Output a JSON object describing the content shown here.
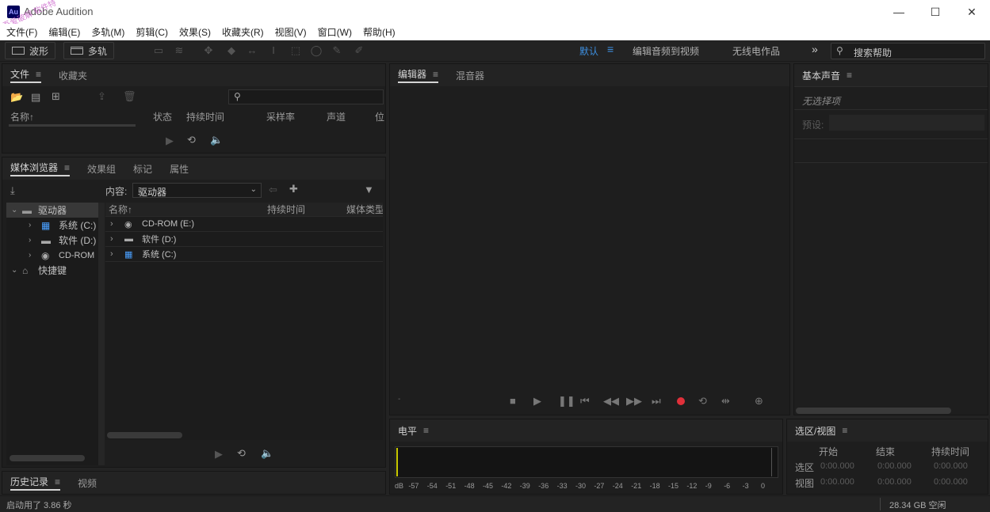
{
  "window": {
    "app_badge": "Au",
    "title": "Adobe Audition",
    "minimize": "—",
    "maximize": "☐",
    "close": "✕"
  },
  "watermark": "吾爱破解 软件特",
  "menu": [
    "文件(F)",
    "编辑(E)",
    "多轨(M)",
    "剪辑(C)",
    "效果(S)",
    "收藏夹(R)",
    "视图(V)",
    "窗口(W)",
    "帮助(H)"
  ],
  "toolbar": {
    "waveform_label": "波形",
    "multitrack_label": "多轨",
    "workspaces": {
      "default": "默认",
      "edit_to_video": "编辑音频到视频",
      "radio": "无线电作品",
      "more": "»"
    },
    "search_placeholder": "搜索帮助"
  },
  "files_panel": {
    "tabs": [
      "文件",
      "收藏夹"
    ],
    "columns": [
      "名称↑",
      "状态",
      "持续时间",
      "采样率",
      "声道",
      "位"
    ]
  },
  "media_panel": {
    "tabs": [
      "媒体浏览器",
      "效果组",
      "标记",
      "属性"
    ],
    "content_label": "内容:",
    "content_value": "驱动器",
    "tree": [
      {
        "label": "驱动器",
        "level": 0,
        "expanded": true,
        "icon": "drive-group-icon"
      },
      {
        "label": "系统 (C:)",
        "level": 1,
        "icon": "system-drive-icon"
      },
      {
        "label": "软件 (D:)",
        "level": 1,
        "icon": "hdd-icon"
      },
      {
        "label": "CD-ROM",
        "level": 1,
        "icon": "cdrom-icon"
      },
      {
        "label": "快捷键",
        "level": 0,
        "expanded": true,
        "icon": "shortcut-icon"
      }
    ],
    "list_columns": [
      "名称↑",
      "持续时间",
      "媒体类型"
    ],
    "list": [
      "CD-ROM (E:)",
      "软件 (D:)",
      "系统 (C:)"
    ]
  },
  "history_panel": {
    "tabs": [
      "历史记录",
      "视频"
    ]
  },
  "editor_panel": {
    "tabs": [
      "编辑器",
      "混音器"
    ]
  },
  "levels_panel": {
    "title": "电平",
    "scale": [
      "dB",
      "-57",
      "-54",
      "-51",
      "-48",
      "-45",
      "-42",
      "-39",
      "-36",
      "-33",
      "-30",
      "-27",
      "-24",
      "-21",
      "-18",
      "-15",
      "-12",
      "-9",
      "-6",
      "-3",
      "0"
    ]
  },
  "essential_sound": {
    "title": "基本声音",
    "no_selection": "无选择项",
    "preset_label": "预设:"
  },
  "selection_view": {
    "title": "选区/视图",
    "columns": [
      "开始",
      "结束",
      "持续时间"
    ],
    "rows": [
      {
        "label": "选区",
        "values": [
          "0:00.000",
          "0:00.000",
          "0:00.000"
        ]
      },
      {
        "label": "视图",
        "values": [
          "0:00.000",
          "0:00.000",
          "0:00.000"
        ]
      }
    ]
  },
  "status": {
    "left": "启动用了 3.86 秒",
    "right": "28.34 GB 空闲"
  },
  "colors": {
    "accent": "#3d8fe0",
    "record": "#e0303a",
    "panel_bg": "#1e1e1e",
    "app_bg": "#232323"
  }
}
